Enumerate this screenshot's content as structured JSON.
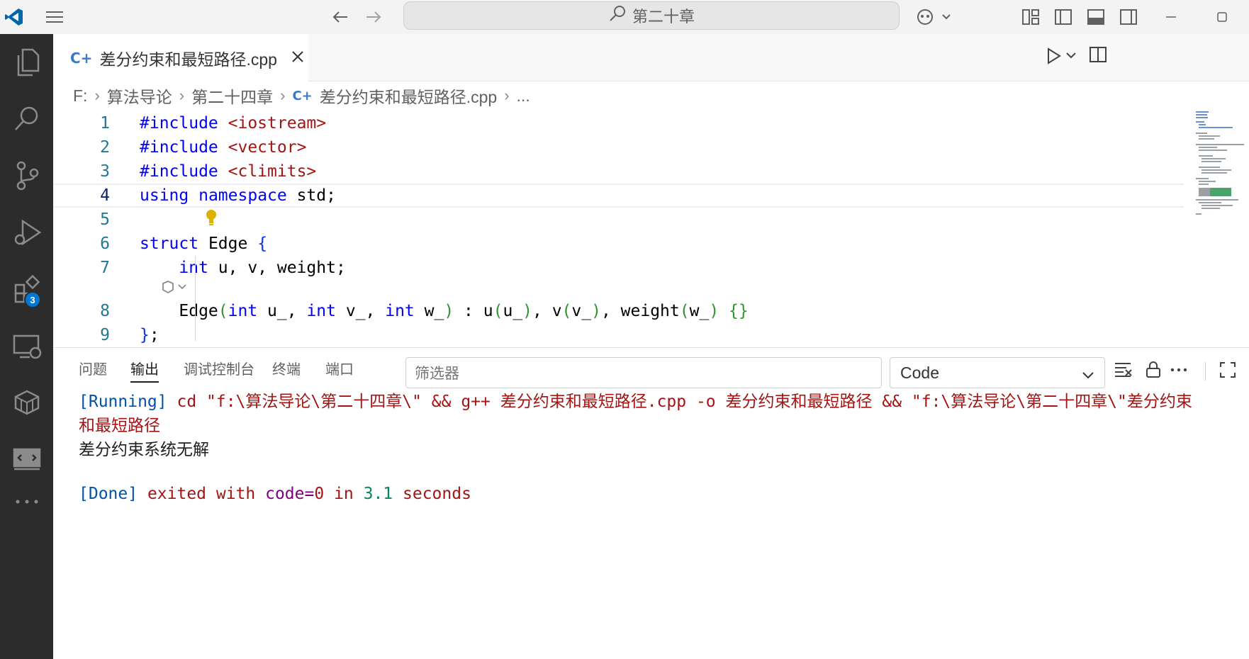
{
  "titlebar": {
    "search_text": "第二十章"
  },
  "activitybar": {
    "extensions_badge": "3"
  },
  "tab": {
    "filename": "差分约束和最短路径.cpp"
  },
  "breadcrumb": [
    "F:",
    "算法导论",
    "第二十四章",
    "差分约束和最短路径.cpp",
    "..."
  ],
  "editor": {
    "lines": [
      {
        "n": "1",
        "text": "#include <iostream>"
      },
      {
        "n": "2",
        "text": "#include <vector>"
      },
      {
        "n": "3",
        "text": "#include <climits>"
      },
      {
        "n": "4",
        "text": "using namespace std;"
      },
      {
        "n": "5",
        "text": ""
      },
      {
        "n": "6",
        "text": "struct Edge {"
      },
      {
        "n": "7",
        "text": "    int u, v, weight;"
      },
      {
        "n": "8",
        "text": "    Edge(int u_, int v_, int w_) : u(u_), v(v_), weight(w_) {}"
      },
      {
        "n": "9",
        "text": "};"
      }
    ]
  },
  "panel": {
    "tabs": [
      "问题",
      "输出",
      "调试控制台",
      "终端",
      "端口"
    ],
    "active_tab": "输出",
    "filter_placeholder": "筛选器",
    "channel": "Code"
  },
  "output": {
    "running_tag": "[Running]",
    "running_cmd": " cd \"f:\\算法导论\\第二十四章\\\" && g++ 差分约束和最短路径.cpp -o 差分约束和最短路径 && \"f:\\算法导论\\第二十四章\\\"差分约束",
    "running_cmd_wrap": "和最短路径",
    "result": "差分约束系统无解",
    "done_tag": "[Done]",
    "done_1": " exited with ",
    "done_2": "code=",
    "done_3": "0",
    "done_4": " in ",
    "done_5": "3.1",
    "done_6": " seconds"
  },
  "colors": {
    "accent": "#0078d4",
    "activitybar_bg": "#2c2c2c"
  }
}
